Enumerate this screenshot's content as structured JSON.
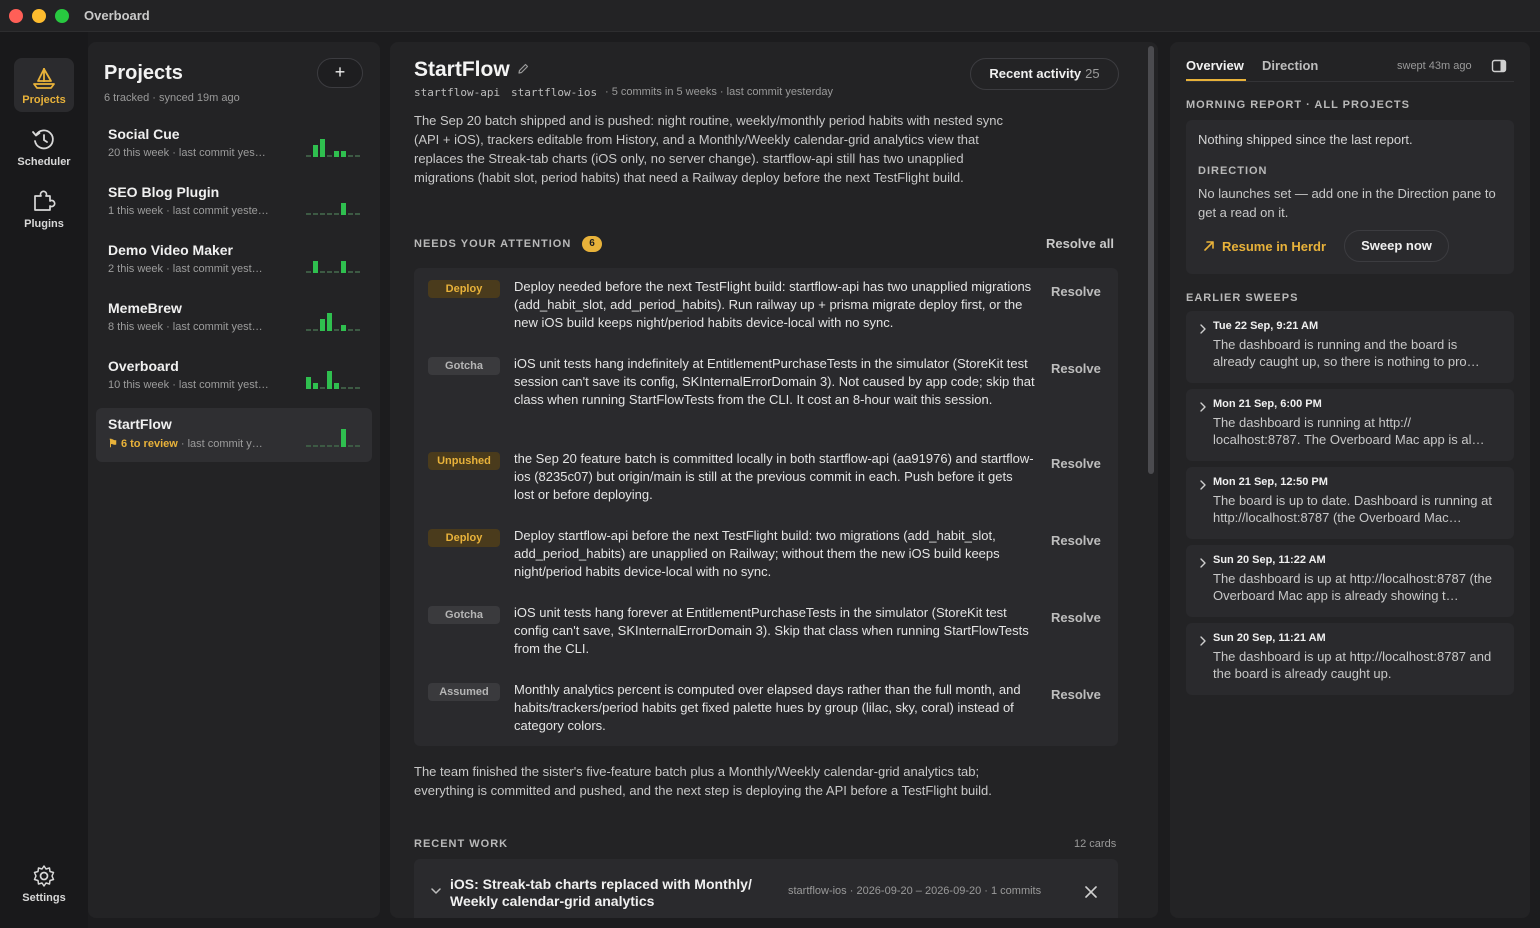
{
  "window": {
    "title": "Overboard"
  },
  "rail": {
    "items": [
      {
        "label": "Projects",
        "icon": "sailboat-icon"
      },
      {
        "label": "Scheduler",
        "icon": "clock-history-icon"
      },
      {
        "label": "Plugins",
        "icon": "puzzle-icon"
      }
    ],
    "settings_label": "Settings"
  },
  "projects": {
    "title": "Projects",
    "subtitle": "6 tracked · synced 19m ago",
    "add_label": "+",
    "items": [
      {
        "name": "Social Cue",
        "meta": "20 this week · last commit yes…",
        "activity": [
          0,
          2,
          3,
          0,
          1,
          1,
          0,
          0
        ]
      },
      {
        "name": "SEO Blog Plugin",
        "meta": "1 this week · last commit yeste…",
        "activity": [
          0,
          0,
          0,
          0,
          0,
          2,
          0,
          0
        ]
      },
      {
        "name": "Demo Video Maker",
        "meta": "2 this week · last commit yest…",
        "activity": [
          0,
          2,
          0,
          0,
          0,
          2,
          0,
          0
        ]
      },
      {
        "name": "MemeBrew",
        "meta": "8 this week · last commit yest…",
        "activity": [
          0,
          0,
          2,
          3,
          0,
          1,
          0,
          0
        ]
      },
      {
        "name": "Overboard",
        "meta": "10 this week · last commit yest…",
        "activity": [
          2,
          1,
          0,
          3,
          1,
          0,
          0,
          0
        ]
      },
      {
        "name": "StartFlow",
        "review": "6 to review",
        "meta": "· last commit y…",
        "activity": [
          0,
          0,
          0,
          0,
          0,
          3,
          0,
          0
        ]
      }
    ]
  },
  "main": {
    "title": "StartFlow",
    "repos": [
      "startflow-api",
      "startflow-ios"
    ],
    "stats": "· 5 commits in 5 weeks · last commit yesterday",
    "activity_label": "Recent activity",
    "activity_count": "25",
    "summary": "The Sep 20 batch shipped and is pushed: night routine, weekly/monthly period habits with nested sync (API + iOS), trackers editable from History, and a Monthly/Weekly calendar-grid analytics view that replaces the Streak-tab charts (iOS only, no server change). startflow-api still has two unapplied migrations (habit slot, period habits) that need a Railway deploy before the next TestFlight build.",
    "attention": {
      "label": "NEEDS YOUR ATTENTION",
      "count": "6",
      "resolve_all": "Resolve all",
      "items": [
        {
          "tag": "Deploy",
          "tone": "gold",
          "text": "Deploy needed before the next TestFlight build: startflow-api has two unapplied migrations (add_habit_slot, add_period_habits). Run railway up + prisma migrate deploy first, or the new iOS build keeps night/period habits device-local with no sync.",
          "action": "Resolve"
        },
        {
          "tag": "Gotcha",
          "tone": "gray",
          "text": "iOS unit tests hang indefinitely at EntitlementPurchaseTests in the simulator (StoreKit test session can't save its config, SKInternalErrorDomain 3). Not caused by app code; skip that class when running StartFlowTests from the CLI. It cost an 8-hour wait this session.",
          "action": "Resolve"
        },
        {
          "tag": "Unpushed",
          "tone": "gold",
          "text": "the Sep 20 feature batch is committed locally in both startflow-api (aa91976) and startflow-ios (8235c07) but origin/main is still at the previous commit in each. Push before it gets lost or before deploying.",
          "action": "Resolve"
        },
        {
          "tag": "Deploy",
          "tone": "gold",
          "text": "Deploy startflow-api before the next TestFlight build: two migrations (add_habit_slot, add_period_habits) are unapplied on Railway; without them the new iOS build keeps night/period habits device-local with no sync.",
          "action": "Resolve"
        },
        {
          "tag": "Gotcha",
          "tone": "gray",
          "text": "iOS unit tests hang forever at EntitlementPurchaseTests in the simulator (StoreKit test config can't save, SKInternalErrorDomain 3). Skip that class when running StartFlowTests from the CLI.",
          "action": "Resolve"
        },
        {
          "tag": "Assumed",
          "tone": "gray",
          "text": "Monthly analytics percent is computed over elapsed days rather than the full month, and habits/trackers/period habits get fixed palette hues by group (lilac, sky, coral) instead of category colors.",
          "action": "Resolve"
        }
      ]
    },
    "wrap_up": "The team finished the sister's five-feature batch plus a Monthly/Weekly calendar-grid analytics tab; everything is committed and pushed, and the next step is deploying the API before a TestFlight build.",
    "recent_work": {
      "label": "RECENT WORK",
      "count": "12 cards",
      "cards": [
        {
          "title": "iOS: Streak-tab charts replaced with Monthly/ Weekly calendar-grid analytics",
          "meta": "startflow-ios · 2026-09-20 – 2026-09-20 · 1 commits"
        }
      ]
    }
  },
  "right": {
    "tabs": [
      "Overview",
      "Direction"
    ],
    "active_tab": "Overview",
    "swept": "swept 43m ago",
    "report_label": "MORNING REPORT · ALL PROJECTS",
    "report_text": "Nothing shipped since the last report.",
    "direction_label": "DIRECTION",
    "direction_text": "No launches set — add one in the Direction pane to get a read on it.",
    "resume_label": "Resume in Herdr",
    "sweep_label": "Sweep now",
    "earlier_label": "EARLIER SWEEPS",
    "sweeps": [
      {
        "date": "Tue 22 Sep, 9:21 AM",
        "text": "The dashboard is running and the board is already caught up, so there is nothing to pro…"
      },
      {
        "date": "Mon 21 Sep, 6:00 PM",
        "text": "The dashboard is running at http:// localhost:8787. The Overboard Mac app is al…"
      },
      {
        "date": "Mon 21 Sep, 12:50 PM",
        "text": "The board is up to date. Dashboard is running at http://localhost:8787 (the Overboard Mac…"
      },
      {
        "date": "Sun 20 Sep, 11:22 AM",
        "text": "The dashboard is up at http://localhost:8787 (the Overboard Mac app is already showing t…"
      },
      {
        "date": "Sun 20 Sep, 11:21 AM",
        "text": "The dashboard is up at http://localhost:8787 and the board is already caught up."
      }
    ]
  },
  "colors": {
    "accent": "#e8b23a",
    "bar_green": "#2fbf4f",
    "bar_dim": "#3d5a44",
    "panel": "#232325",
    "card": "#2a2a2d"
  }
}
